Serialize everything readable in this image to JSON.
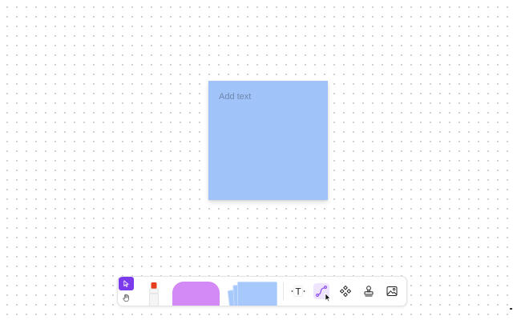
{
  "canvas": {
    "sticky_note": {
      "placeholder": "Add text",
      "color": "#a0c4fa"
    }
  },
  "toolbar": {
    "modes": [
      {
        "name": "select",
        "icon": "cursor-arrow-icon",
        "active": true
      },
      {
        "name": "hand",
        "icon": "hand-icon",
        "active": false
      }
    ],
    "tools": [
      {
        "name": "marker",
        "icon": "marker-icon",
        "color": "#e53e1f"
      },
      {
        "name": "shapes",
        "icon": "shape-icon",
        "color": "#d38af7"
      },
      {
        "name": "sticky-notes",
        "icon": "sticky-note-stack-icon",
        "color": "#a6c8fb"
      },
      {
        "name": "text",
        "icon": "text-icon",
        "label": "T"
      },
      {
        "name": "connector",
        "icon": "connector-icon",
        "active": true
      },
      {
        "name": "component",
        "icon": "component-icon"
      },
      {
        "name": "stamp",
        "icon": "stamp-icon"
      },
      {
        "name": "image",
        "icon": "image-icon"
      }
    ],
    "accent_color": "#7c3aed"
  }
}
